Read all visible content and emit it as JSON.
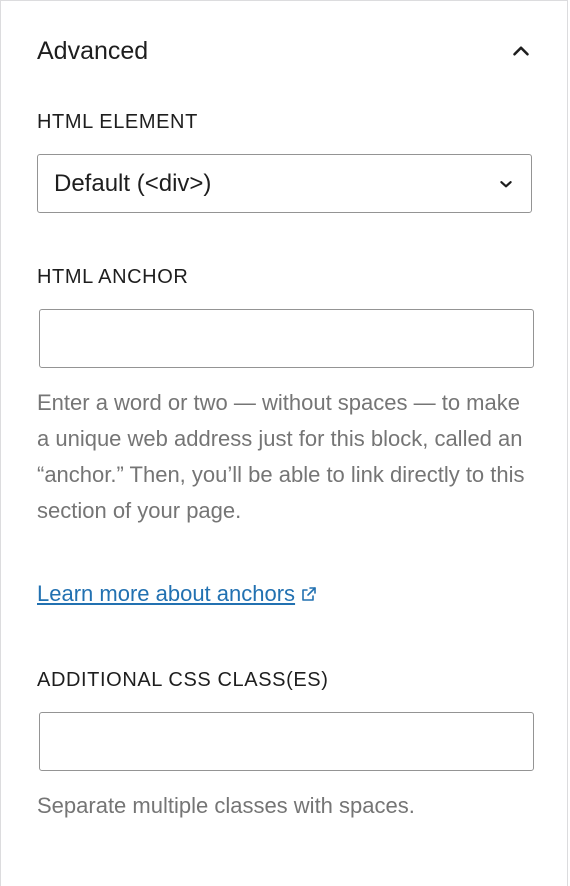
{
  "panel": {
    "title": "Advanced",
    "expanded": true
  },
  "html_element": {
    "label": "HTML ELEMENT",
    "selected": "Default (<div>)"
  },
  "html_anchor": {
    "label": "HTML ANCHOR",
    "value": "",
    "help": "Enter a word or two — without spaces — to make a unique web address just for this block, called an “anchor.” Then, you’ll be able to link directly to this section of your page.",
    "link_text": "Learn more about anchors"
  },
  "css_classes": {
    "label": "ADDITIONAL CSS CLASS(ES)",
    "value": "",
    "help": "Separate multiple classes with spaces."
  },
  "colors": {
    "link": "#2271b1",
    "help_text": "#757575",
    "border": "#949494"
  },
  "icons": {
    "collapse": "chevron-up-icon",
    "select_caret": "chevron-down-icon",
    "external_link": "external-link-icon"
  }
}
